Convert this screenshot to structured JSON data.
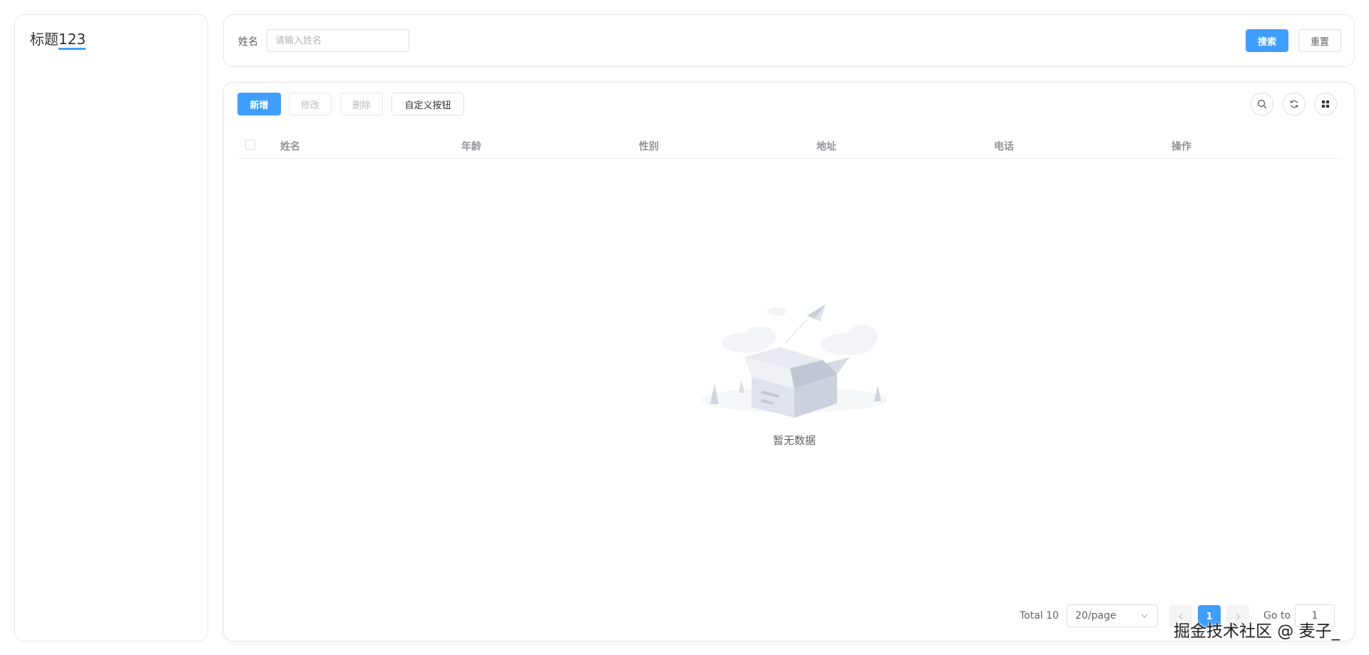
{
  "sidebar": {
    "title_prefix": "标题",
    "title_number": "123"
  },
  "search": {
    "label": "姓名",
    "placeholder": "请输入姓名",
    "search_button": "搜索",
    "reset_button": "重置"
  },
  "toolbar": {
    "add": "新增",
    "edit": "修改",
    "delete": "删除",
    "custom": "自定义按钮",
    "icons": [
      "search-icon",
      "refresh-icon",
      "grid-icon"
    ]
  },
  "table": {
    "columns": [
      "姓名",
      "年龄",
      "性别",
      "地址",
      "电话",
      "操作"
    ],
    "rows": [],
    "empty_text": "暂无数据"
  },
  "pagination": {
    "total_label": "Total 10",
    "page_size": "20/page",
    "current_page": "1",
    "goto_label": "Go to",
    "goto_value": "1"
  },
  "watermark": "掘金技术社区 @ 麦子_",
  "colors": {
    "primary": "#409eff",
    "border": "#dcdfe6"
  }
}
